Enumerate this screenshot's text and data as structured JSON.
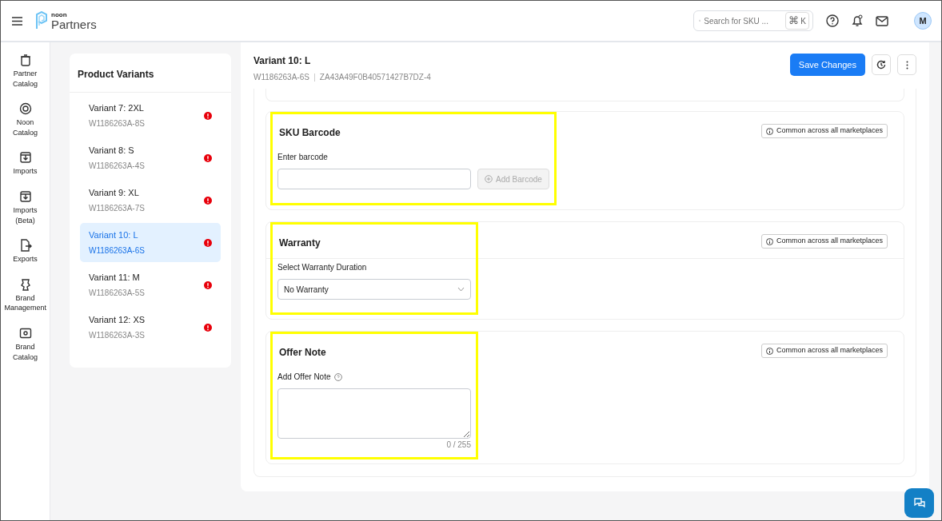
{
  "topbar": {
    "brand_small": "noon",
    "brand_large": "Partners",
    "search": {
      "placeholder": "Search for SKU ...",
      "shortcut_symbol": "⌘",
      "shortcut_key": "K"
    },
    "avatar": "M"
  },
  "nav_rail": [
    {
      "label": "Partner Catalog"
    },
    {
      "label": "Noon Catalog"
    },
    {
      "label": "Imports"
    },
    {
      "label": "Imports (Beta)"
    },
    {
      "label": "Exports"
    },
    {
      "label": "Brand Management"
    },
    {
      "label": "Brand Catalog"
    }
  ],
  "variants_panel": {
    "title": "Product Variants",
    "items": [
      {
        "name": "Variant 7: 2XL",
        "sku": "W1186263A-8S",
        "selected": false,
        "error": true
      },
      {
        "name": "Variant 8: S",
        "sku": "W1186263A-4S",
        "selected": false,
        "error": true
      },
      {
        "name": "Variant 9: XL",
        "sku": "W1186263A-7S",
        "selected": false,
        "error": true
      },
      {
        "name": "Variant 10: L",
        "sku": "W1186263A-6S",
        "selected": true,
        "error": true
      },
      {
        "name": "Variant 11: M",
        "sku": "W1186263A-5S",
        "selected": false,
        "error": true
      },
      {
        "name": "Variant 12: XS",
        "sku": "W1186263A-3S",
        "selected": false,
        "error": true
      }
    ]
  },
  "detail": {
    "title": "Variant 10: L",
    "sku": "W1186263A-6S",
    "id": "ZA43A49F0B40571427B7DZ-4",
    "save_button": "Save Changes",
    "sections": [
      {
        "kind": "barcode",
        "title": "SKU Barcode",
        "badge": "Common across all marketplaces",
        "highlighted": true,
        "field_label": "Enter barcode",
        "button": "Add Barcode",
        "button_disabled": true
      },
      {
        "kind": "select",
        "title": "Warranty",
        "badge": "Common across all marketplaces",
        "highlighted": true,
        "field_label": "Select Warranty Duration",
        "value": "No Warranty"
      },
      {
        "kind": "textarea",
        "title": "Offer Note",
        "badge": "Common across all marketplaces",
        "highlighted": true,
        "field_label": "Add Offer Note",
        "counter": "0 / 255"
      }
    ]
  }
}
